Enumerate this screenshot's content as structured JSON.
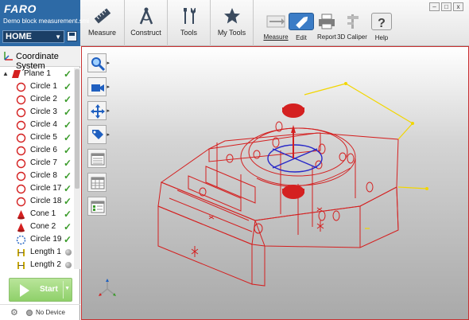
{
  "brand": {
    "logo": "FARO",
    "file_name": "Demo block measurement.smi",
    "home_label": "HOME"
  },
  "main_tabs": [
    {
      "label": "Measure",
      "icon": "measure-ruler-icon"
    },
    {
      "label": "Construct",
      "icon": "compass-icon"
    },
    {
      "label": "Tools",
      "icon": "tools-icon"
    },
    {
      "label": "My Tools",
      "icon": "star-icon"
    }
  ],
  "toolbar": [
    {
      "label": "Measure",
      "icon": "measure-arrow-icon"
    },
    {
      "label": "Edit",
      "icon": "pencil-icon"
    },
    {
      "label": "Report",
      "icon": "printer-icon"
    },
    {
      "label": "3D Caliper",
      "icon": "caliper-icon"
    },
    {
      "label": "Help",
      "icon": "help-icon"
    }
  ],
  "window": {
    "minimize": "–",
    "maximize": "□",
    "close": "x"
  },
  "coord_system": "Coordinate System",
  "tree": [
    {
      "label": "Plane 1",
      "type": "plane",
      "status": "ok"
    },
    {
      "label": "Circle 1",
      "type": "circle",
      "status": "ok"
    },
    {
      "label": "Circle 2",
      "type": "circle",
      "status": "ok"
    },
    {
      "label": "Circle 3",
      "type": "circle",
      "status": "ok"
    },
    {
      "label": "Circle 4",
      "type": "circle",
      "status": "ok"
    },
    {
      "label": "Circle 5",
      "type": "circle",
      "status": "ok"
    },
    {
      "label": "Circle 6",
      "type": "circle",
      "status": "ok"
    },
    {
      "label": "Circle 7",
      "type": "circle",
      "status": "ok"
    },
    {
      "label": "Circle 8",
      "type": "circle",
      "status": "ok"
    },
    {
      "label": "Circle 17",
      "type": "circle",
      "status": "ok"
    },
    {
      "label": "Circle 18",
      "type": "circle",
      "status": "ok"
    },
    {
      "label": "Cone 1",
      "type": "cone",
      "status": "ok"
    },
    {
      "label": "Cone 2",
      "type": "cone",
      "status": "ok"
    },
    {
      "label": "Circle 19",
      "type": "circle-dashed",
      "status": "ok"
    },
    {
      "label": "Length 1",
      "type": "length",
      "status": "pending"
    },
    {
      "label": "Length 2",
      "type": "length",
      "status": "pending"
    }
  ],
  "start_label": "Start",
  "device_status": "No Device",
  "colors": {
    "brand_blue": "#2d6aa6",
    "feature_red": "#d42020",
    "check_green": "#3a9b2a",
    "active_blue": "#3b7cc6"
  }
}
